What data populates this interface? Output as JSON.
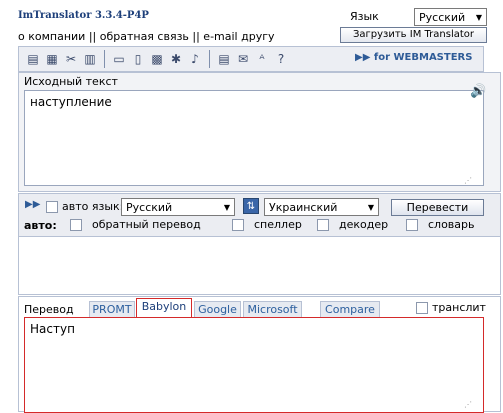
{
  "app": {
    "title": "ImTranslator 3.3.4-P4P",
    "language_label": "Язык",
    "language_value": "Русский",
    "load_button": "Загрузить IM Translator",
    "links": "о компании || обратная связь || e-mail другу"
  },
  "toolbar": {
    "webmasters_label": "for WEBMASTERS",
    "icons": [
      "clipboard-icon",
      "print-icon",
      "cut-icon",
      "trash-icon",
      "dictionary-icon",
      "spellcheck-icon",
      "keyboard-icon",
      "settings-icon",
      "voice-icon",
      "printer-icon",
      "email-icon",
      "font-size-icon",
      "help-icon"
    ]
  },
  "source": {
    "label": "Исходный текст",
    "text": "наступление"
  },
  "controls": {
    "auto_lang_label": "авто язык:",
    "from_lang": "Русский",
    "to_lang": "Украинский",
    "translate_button": "Перевести",
    "auto_label": "авто:",
    "reverse_label": "обратный перевод",
    "speller_label": "спеллер",
    "decoder_label": "декодер",
    "dictionary_label": "словарь"
  },
  "result": {
    "label": "Перевод",
    "tabs": [
      "PROMT",
      "Babylon",
      "Google",
      "Microsoft",
      "Compare"
    ],
    "active_tab": "Babylon",
    "translit_label": "транслит",
    "text": "Наступ"
  },
  "colors": {
    "accent": "#2e5b97",
    "active_tab_border": "#d42a2a"
  }
}
